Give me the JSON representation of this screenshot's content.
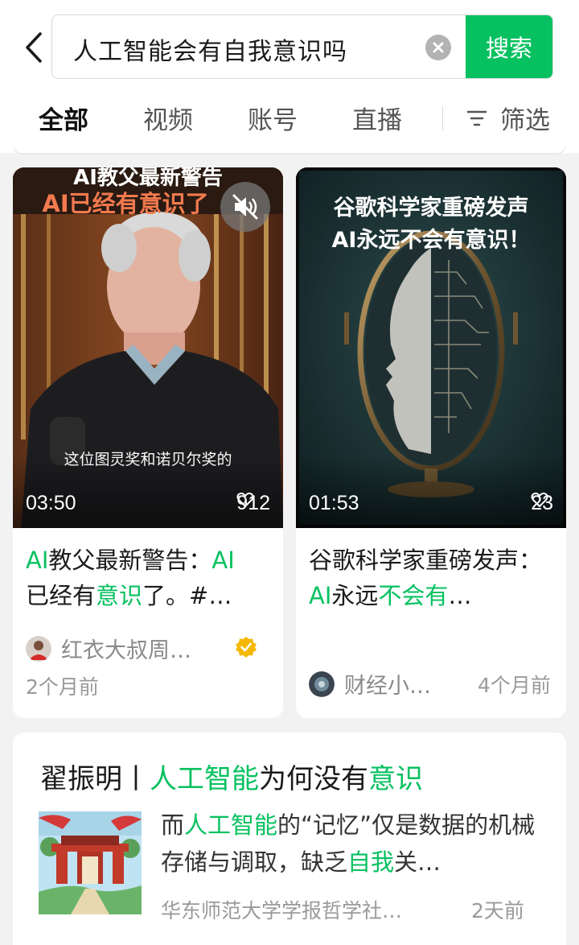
{
  "search": {
    "query": "人工智能会有自我意识吗",
    "button_label": "搜索"
  },
  "tabs": [
    {
      "label": "全部",
      "active": true
    },
    {
      "label": "视频",
      "active": false
    },
    {
      "label": "账号",
      "active": false
    },
    {
      "label": "直播",
      "active": false
    }
  ],
  "filter_label": "筛选",
  "videos": [
    {
      "overlay_line1": "AI教父最新警告",
      "overlay_line2": "AI已经有意识了",
      "subtitle": "这位图灵奖和诺贝尔奖的",
      "duration": "03:50",
      "likes": "912",
      "title_parts": [
        "AI",
        "教父最新警告：",
        "AI",
        "已经有",
        "意识",
        "了。#…"
      ],
      "author": "红衣大叔周…",
      "verified": true,
      "time": "2个月前"
    },
    {
      "overlay_line1": "谷歌科学家重磅发声",
      "overlay_line2": "AI永远不会有意识！",
      "duration": "01:53",
      "likes": "23",
      "title_parts": [
        "谷歌科学家重磅发声：",
        "AI",
        "永远",
        "不会有",
        "…"
      ],
      "author": "财经小…",
      "time": "4个月前"
    }
  ],
  "article": {
    "title_parts": [
      "翟振明丨",
      "人工智能",
      "为何没有",
      "意识"
    ],
    "snippet_parts": [
      "而",
      "人工智能",
      "的“记忆”仅是数据的机械存储与调取，缺乏",
      "自我",
      "关…"
    ],
    "source": "华东师范大学学报哲学社…",
    "time": "2天前"
  },
  "colors": {
    "accent": "#07c160",
    "text": "#191919",
    "muted": "#9a9a9a",
    "background": "#f2f2f2"
  },
  "icons": [
    "back-arrow-icon",
    "clear-icon",
    "filter-icon",
    "mute-icon",
    "heart-icon",
    "verified-icon"
  ]
}
